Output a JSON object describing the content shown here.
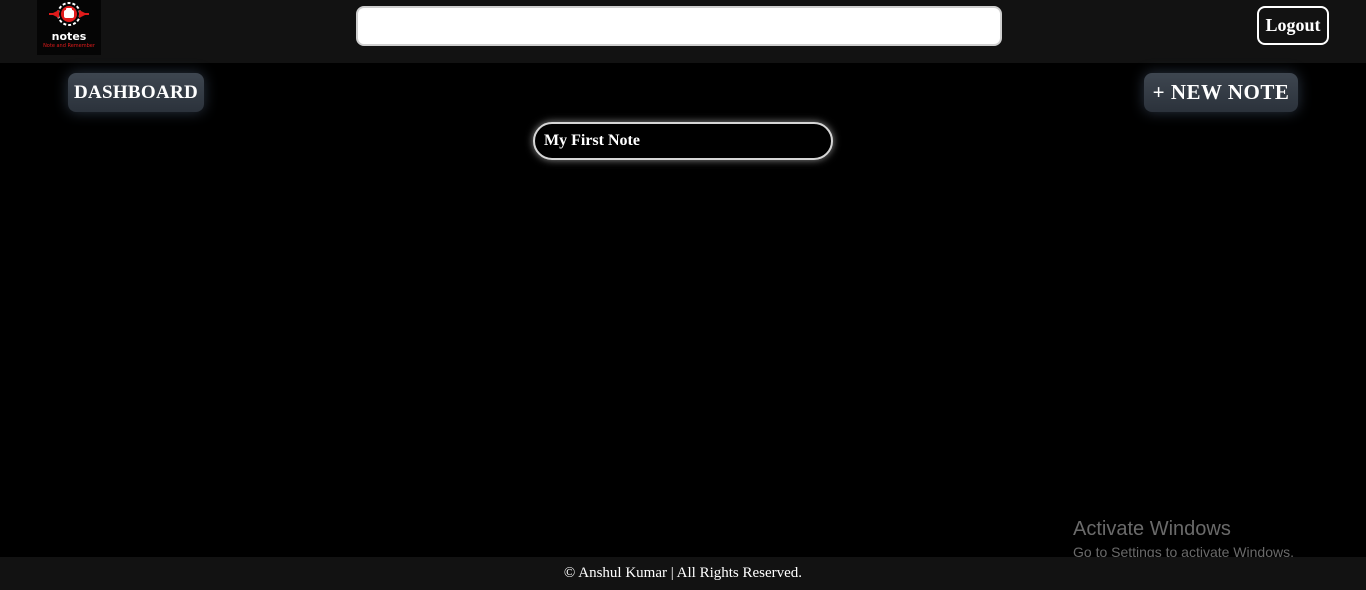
{
  "header": {
    "logo_text": "notes",
    "logo_tagline": "Note and Remember",
    "search_value": "",
    "search_placeholder": "",
    "logout_label": "Logout"
  },
  "toolbar": {
    "dashboard_label": "DASHBOARD",
    "new_note_label": "+ NEW NOTE"
  },
  "notes": [
    {
      "title": "My First Note"
    }
  ],
  "footer": {
    "text": "© Anshul Kumar | All Rights Reserved."
  },
  "watermark": {
    "title": "Activate Windows",
    "subtitle": "Go to Settings to activate Windows."
  },
  "colors": {
    "background": "#000000",
    "header_bg": "#121212",
    "button_bg": "#2f363f",
    "logo_accent": "#e01b1b"
  }
}
